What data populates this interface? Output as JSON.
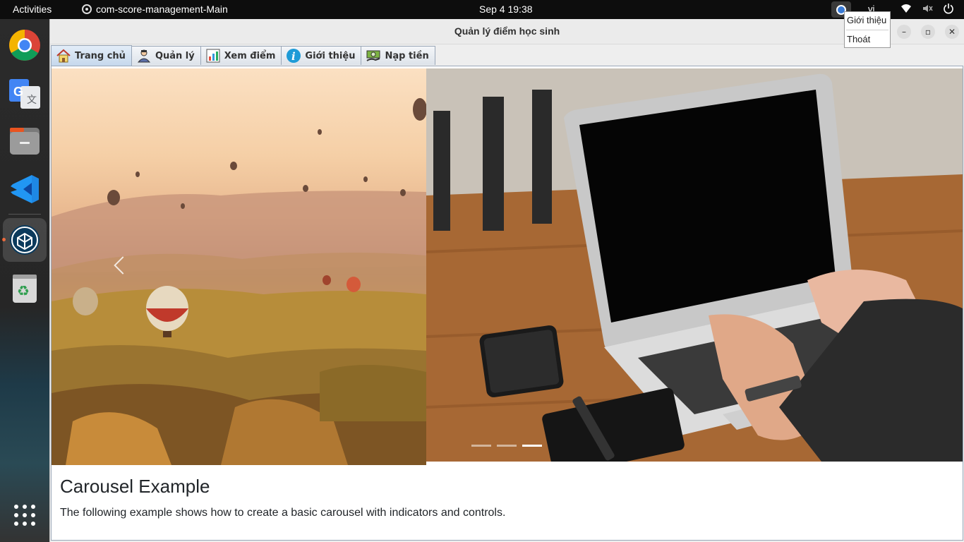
{
  "topbar": {
    "activities": "Activities",
    "app_name": "com-score-management-Main",
    "clock": "Sep 4  19:38",
    "lang": "vi"
  },
  "dock": {
    "items": [
      {
        "name": "chrome-icon"
      },
      {
        "name": "google-translate-icon"
      },
      {
        "name": "files-icon"
      },
      {
        "name": "vscode-icon"
      },
      {
        "name": "java-app-icon",
        "active": true
      },
      {
        "name": "trash-icon"
      },
      {
        "name": "app-grid-icon"
      }
    ]
  },
  "window": {
    "title": "Quản lý điểm học sinh",
    "tabs": [
      {
        "label": "Trang chủ",
        "icon": "home-icon",
        "active": true
      },
      {
        "label": "Quản lý",
        "icon": "people-icon"
      },
      {
        "label": "Xem điểm",
        "icon": "chart-icon"
      },
      {
        "label": "Giới thiệu",
        "icon": "info-icon"
      },
      {
        "label": "Nạp tiền",
        "icon": "money-icon"
      }
    ]
  },
  "carousel": {
    "indicators": 3,
    "active_index": 2,
    "caption_title": "Carousel Example",
    "caption_text": "The following example shows how to create a basic carousel with indicators and controls."
  },
  "popup_menu": {
    "items": [
      "Giới thiệu",
      "Thoát"
    ]
  },
  "colors": {
    "topbar": "#0d0d0d",
    "tab_active": "#c6d8ec",
    "tab_border": "#9aa7b8",
    "running_dot": "#e95420"
  }
}
